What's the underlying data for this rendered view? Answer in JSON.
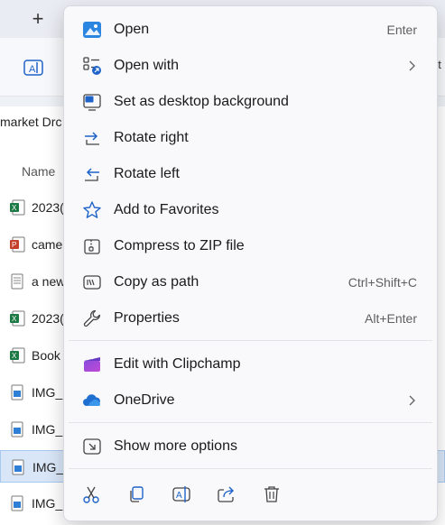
{
  "explorer": {
    "address": "market Drc",
    "column_name": "Name",
    "files": [
      {
        "name": "2023(",
        "icon": "excel-file-icon"
      },
      {
        "name": "came",
        "icon": "powerpoint-file-icon"
      },
      {
        "name": "a new",
        "icon": "text-file-icon"
      },
      {
        "name": "2023(",
        "icon": "excel-file-icon"
      },
      {
        "name": "Book",
        "icon": "excel-file-icon"
      },
      {
        "name": "IMG_(",
        "icon": "image-file-icon"
      },
      {
        "name": "IMG_(",
        "icon": "image-file-icon"
      },
      {
        "name": "IMG_(",
        "icon": "image-file-icon"
      },
      {
        "name": "IMG_(",
        "icon": "image-file-icon"
      }
    ],
    "toolbar_right_fragment": "et",
    "new_tab": "+"
  },
  "menu": {
    "items": [
      {
        "label": "Open",
        "shortcut": "Enter",
        "icon": "photos-app-icon"
      },
      {
        "label": "Open with",
        "shortcut": "",
        "icon": "open-with-icon",
        "submenu": true
      },
      {
        "label": "Set as desktop background",
        "shortcut": "",
        "icon": "desktop-background-icon"
      },
      {
        "label": "Rotate right",
        "shortcut": "",
        "icon": "rotate-right-icon"
      },
      {
        "label": "Rotate left",
        "shortcut": "",
        "icon": "rotate-left-icon"
      },
      {
        "label": "Add to Favorites",
        "shortcut": "",
        "icon": "star-icon"
      },
      {
        "label": "Compress to ZIP file",
        "shortcut": "",
        "icon": "zip-icon"
      },
      {
        "label": "Copy as path",
        "shortcut": "Ctrl+Shift+C",
        "icon": "copy-path-icon"
      },
      {
        "label": "Properties",
        "shortcut": "Alt+Enter",
        "icon": "wrench-icon"
      },
      {
        "label": "Edit with Clipchamp",
        "shortcut": "",
        "icon": "clipchamp-icon"
      },
      {
        "label": "OneDrive",
        "shortcut": "",
        "icon": "onedrive-icon",
        "submenu": true
      },
      {
        "label": "Show more options",
        "shortcut": "",
        "icon": "show-more-options-icon"
      }
    ],
    "quick_actions": [
      "cut-icon",
      "copy-icon",
      "rename-icon",
      "share-icon",
      "delete-icon"
    ]
  },
  "colors": {
    "accent": "#1f63c8",
    "selection": "#d8e6f8",
    "menu_bg": "#f9f9fb"
  }
}
